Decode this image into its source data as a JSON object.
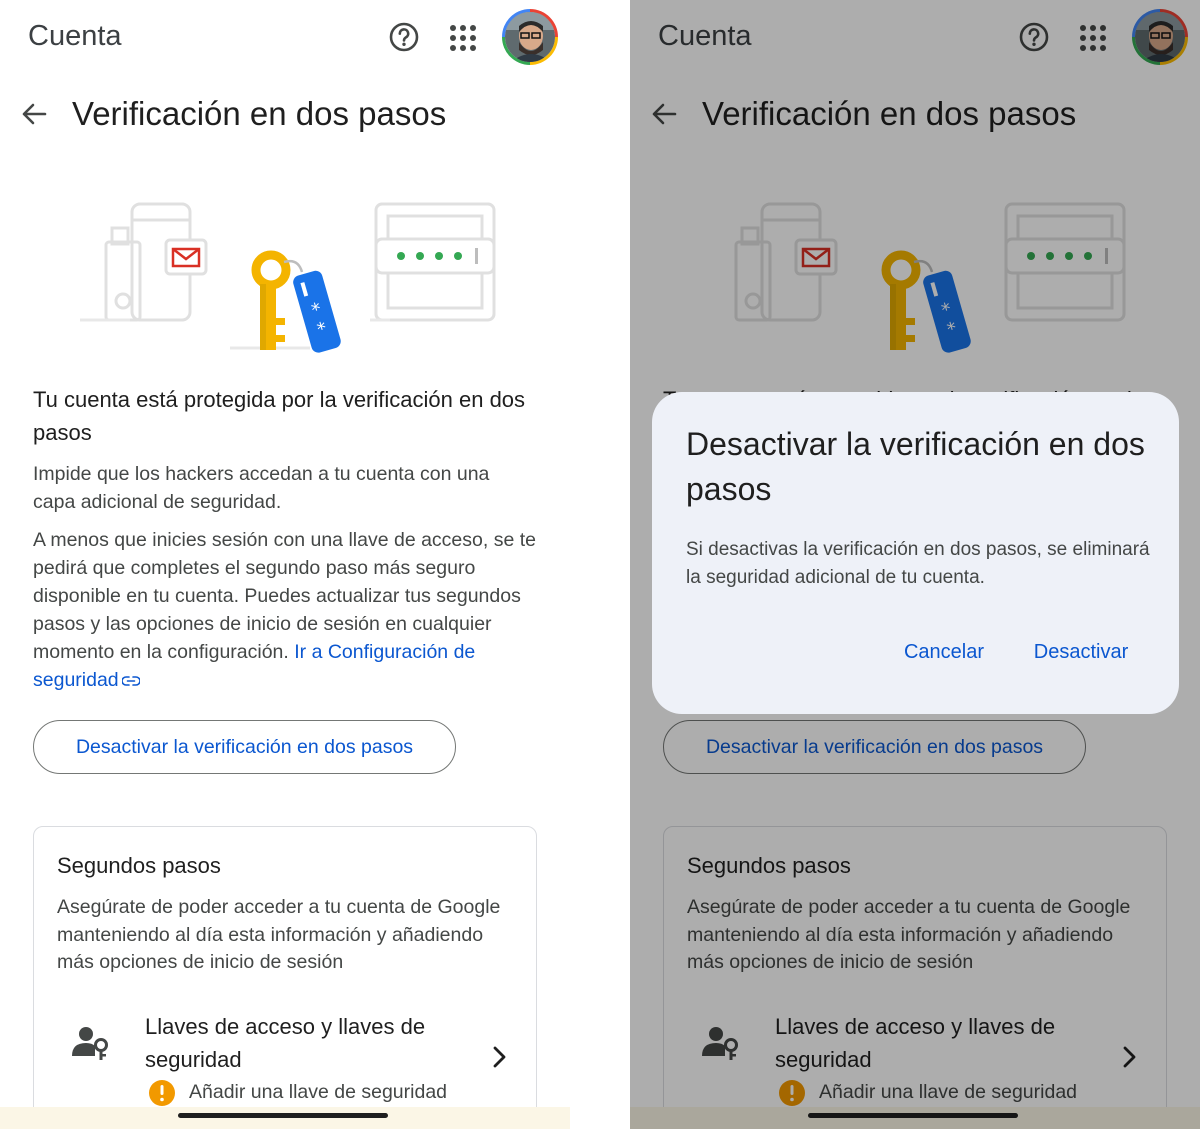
{
  "appbar": {
    "title": "Cuenta"
  },
  "page": {
    "title": "Verificación en dos pasos"
  },
  "protection": {
    "heading": "Tu cuenta está protegida por la verificación en dos pasos",
    "intro": "Impide que los hackers accedan a tu cuenta con una capa adicional de seguridad.",
    "body": "A menos que inicies sesión con una llave de acceso, se te pedirá que completes el segundo paso más seguro disponible en tu cuenta. Puedes actualizar tus segundos pasos y las opciones de inicio de sesión en cualquier momento en la configuración. ",
    "link_label": "Ir a Configuración de seguridad"
  },
  "deactivate_button": "Desactivar la verificación en dos pasos",
  "second_steps": {
    "title": "Segundos pasos",
    "description": "Asegúrate de poder acceder a tu cuenta de Google manteniendo al día esta información y añadiendo más opciones de inicio de sesión",
    "item": {
      "title": "Llaves de acceso y llaves de seguridad",
      "subtitle": "Añadir una llave de seguridad"
    }
  },
  "dialog": {
    "title": "Desactivar la verificación en dos pasos",
    "text": "Si desactivas la verificación en dos pasos, se eliminará la seguridad adicional de tu cuenta.",
    "cancel_label": "Cancelar",
    "confirm_label": "Desactivar"
  },
  "colors": {
    "accent": "#0b57d0",
    "warning": "#f29900",
    "key_yellow": "#f4b400",
    "tag_blue": "#1a73e8",
    "dots_green": "#34a853",
    "mail_red": "#d93025"
  },
  "icons": {
    "help": "help-icon",
    "apps": "apps-grid-icon",
    "back": "back-arrow-icon",
    "link": "link-icon",
    "passkey": "person-key-icon",
    "chevron": "chevron-right-icon",
    "warning": "warning-icon"
  }
}
